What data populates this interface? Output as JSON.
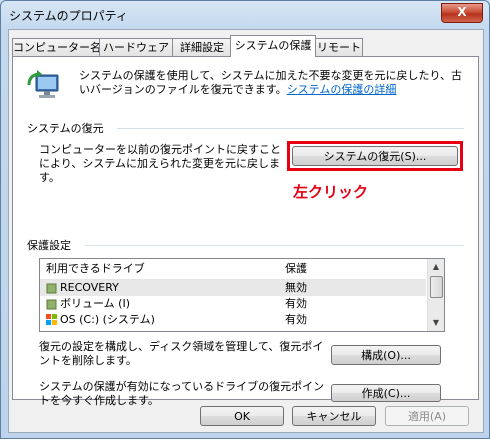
{
  "window": {
    "title": "システムのプロパティ",
    "close_label": "X"
  },
  "tabs": [
    {
      "label": "コンピューター名",
      "active": false
    },
    {
      "label": "ハードウェア",
      "active": false
    },
    {
      "label": "詳細設定",
      "active": false
    },
    {
      "label": "システムの保護",
      "active": true
    },
    {
      "label": "リモート",
      "active": false
    }
  ],
  "intro": {
    "text": "システムの保護を使用して、システムに加えた不要な変更を元に戻したり、古いバージョンのファイルを復元できます。",
    "link": "システムの保護の詳細"
  },
  "restore": {
    "group_title": "システムの復元",
    "description": "コンピューターを以前の復元ポイントに戻すことにより、システムに加えられた変更を元に戻します。",
    "button": "システムの復元(S)...",
    "annotation": "左クリック",
    "highlight_color": "#e60012"
  },
  "protection": {
    "group_title": "保護設定",
    "columns": [
      "利用できるドライブ",
      "保護"
    ],
    "drives": [
      {
        "name": "RECOVERY",
        "status": "無効",
        "icon": "drive-icon"
      },
      {
        "name": "ボリューム (I)",
        "status": "有効",
        "icon": "drive-icon"
      },
      {
        "name": "OS (C:) (システム)",
        "status": "有効",
        "icon": "system-drive-icon"
      }
    ],
    "configure_text": "復元の設定を構成し、ディスク領域を管理して、復元ポイントを削除します。",
    "configure_button": "構成(O)...",
    "create_text": "システムの保護が有効になっているドライブの復元ポイントを今すぐ作成します。",
    "create_button": "作成(C)..."
  },
  "footer": {
    "ok": "OK",
    "cancel": "キャンセル",
    "apply": "適用(A)"
  }
}
